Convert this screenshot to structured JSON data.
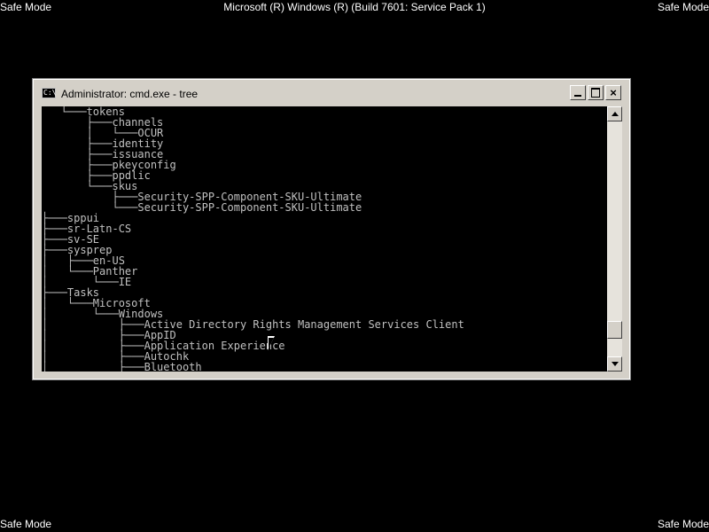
{
  "overlay": {
    "top_left": "Safe Mode",
    "top_right": "Safe Mode",
    "bottom_left": "Safe Mode",
    "bottom_right": "Safe Mode",
    "top_center": "Microsoft (R) Windows (R) (Build 7601: Service Pack 1)"
  },
  "window": {
    "title": "Administrator: cmd.exe - tree",
    "icon_text": "C:\\",
    "controls": {
      "minimize": "",
      "maximize": "",
      "close": "×"
    }
  },
  "console": {
    "text_color": "#c0c0c0",
    "lines": [
      "   └───tokens",
      "       ├───channels",
      "       │   └───OCUR",
      "       ├───identity",
      "       ├───issuance",
      "       ├───pkeyconfig",
      "       ├───ppdlic",
      "       └───skus",
      "           ├───Security-SPP-Component-SKU-Ultimate",
      "           └───Security-SPP-Component-SKU-Ultimate",
      "├───sppui",
      "├───sr-Latn-CS",
      "├───sv-SE",
      "├───sysprep",
      "│   ├───en-US",
      "│   └───Panther",
      "│       └───IE",
      "├───Tasks",
      "│   └───Microsoft",
      "│       └───Windows",
      "│           ├───Active Directory Rights Management Services Client",
      "│           ├───AppID",
      "│           ├───Application Experience",
      "│           ├───Autochk",
      "│           ├───Bluetooth"
    ]
  },
  "scrollbar": {
    "position_fraction": 0.92
  }
}
